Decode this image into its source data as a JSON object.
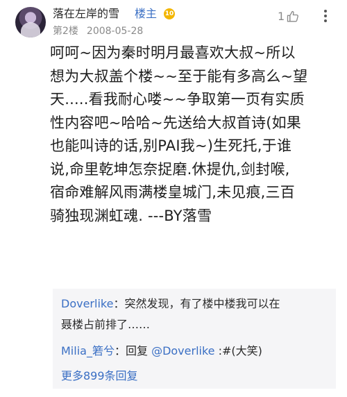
{
  "post": {
    "username": "落在左岸的雪",
    "owner_tag": "楼主",
    "level": "10",
    "floor": "第2楼",
    "date": "2008-05-28",
    "like_count": "1",
    "body_lines": [
      "呵呵~因为秦时明月最喜欢大叔~所以",
      "想为大叔盖个楼~~至于能有多高么~望",
      "天.....看我耐心喽~~争取第一页有实质",
      "性内容吧~哈哈~先送给大叔首诗(如果",
      "也能叫诗的话,别PAI我~)生死托,于谁",
      "说,命里乾坤怎奈捉磨.休提仇,剑封喉,",
      "宿命难解风雨满楼皇城门,未见痕,三百",
      "骑独现渊虹魂. ---BY落雪"
    ]
  },
  "replies": [
    {
      "name": "Doverlike",
      "sep": "：",
      "text_line1": "突然发现，有了楼中楼我可以在",
      "text_line2": "聂楼占前排了……"
    },
    {
      "name": "Milia_箬兮",
      "sep": "：",
      "prefix": "回复 ",
      "mention": "@Doverlike",
      "text": " :#(大笑)"
    }
  ],
  "more_replies": "更多899条回复",
  "icons": {
    "like": "thumb-up-icon",
    "more": "more-dots-icon",
    "level": "level-badge-icon"
  },
  "colors": {
    "link": "#3a6fc4",
    "badge": "#f3b600",
    "meta": "#8a8a8a",
    "reply_bg": "#f5f5f7"
  }
}
